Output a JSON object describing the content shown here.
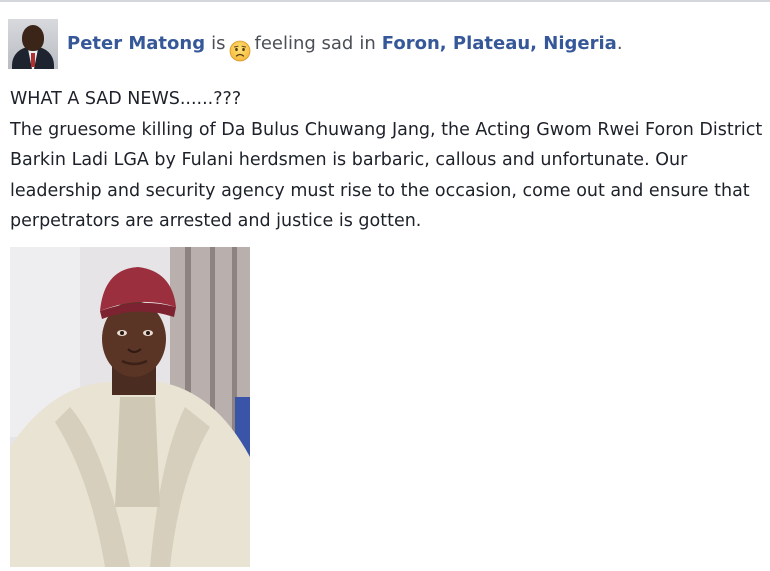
{
  "post": {
    "author_name": "Peter Matong",
    "is_word": "is",
    "feeling_icon": "sad-face-emoji",
    "feeling_text": "feeling sad",
    "in_word": "in",
    "location": "Foron, Plateau, Nigeria",
    "period": ".",
    "headline": "WHAT A SAD NEWS......???",
    "body": "The gruesome killing of Da Bulus Chuwang Jang, the Acting Gwom Rwei Foron District Barkin Ladi LGA by Fulani herdsmen is barbaric, callous and unfortunate. Our leadership and security agency must rise to the occasion, come out and ensure that perpetrators are arrested and justice is gotten."
  },
  "colors": {
    "link_blue": "#365899",
    "text": "#1d2129",
    "muted": "#4b4f56"
  }
}
